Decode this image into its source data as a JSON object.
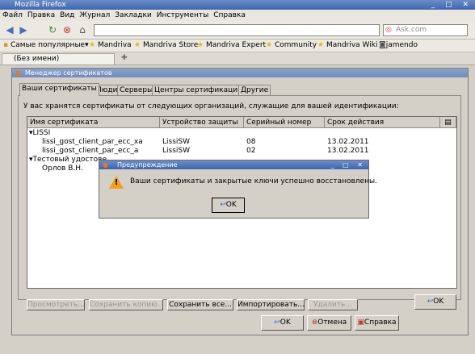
{
  "browser": {
    "title": "Mozilla Firefox",
    "window_buttons": "_ □ ✕",
    "menu": [
      "Файл",
      "Правка",
      "Вид",
      "Журнал",
      "Закладки",
      "Инструменты",
      "Справка"
    ],
    "search_placeholder": "Ask.com",
    "bookmarks": {
      "most_visited": "Самые популярные",
      "items": [
        "Mandriva",
        "Mandriva Store",
        "Mandriva Expert",
        "Community",
        "Mandriva Wiki",
        "jamendo"
      ]
    },
    "tab_label": "(Без имени)",
    "new_tab": "✚"
  },
  "cert_manager": {
    "title": "Менеджер сертификатов",
    "tabs": [
      "Ваши сертификаты",
      "Люди",
      "Серверы",
      "Центры сертификации",
      "Другие"
    ],
    "description": "У вас хранятся сертификаты от следующих организаций, служащие для вашей идентификации:",
    "columns": [
      "Имя сертификата",
      "Устройство защиты",
      "Серийный номер",
      "Срок действия"
    ],
    "groups": [
      {
        "name": "LISSI",
        "rows": [
          {
            "name": "lissi_gost_client_par_ecc_xa",
            "device": "LissiSW",
            "serial": "08",
            "expiry": "13.02.2011"
          },
          {
            "name": "lissi_gost_client_par_ecc_a",
            "device": "LissiSW",
            "serial": "02",
            "expiry": "13.02.2011"
          }
        ]
      },
      {
        "name": "Тестовый удостове",
        "rows": [
          {
            "name": "Орлов В.Н.",
            "device": "",
            "serial": "",
            "expiry": ""
          }
        ]
      }
    ],
    "buttons": {
      "view": "Просмотреть...",
      "backup": "Сохранить копию...",
      "backup_all": "Сохранить все...",
      "import": "Импортировать...",
      "delete": "Удалить..."
    },
    "ok": "OK"
  },
  "dialog_buttons": {
    "ok": "OK",
    "cancel": "Отмена",
    "help": "Справка"
  },
  "alert": {
    "title": "Предупреждение",
    "message": "Ваши сертификаты и закрытые ключи успешно восстановлены.",
    "ok": "OK"
  }
}
